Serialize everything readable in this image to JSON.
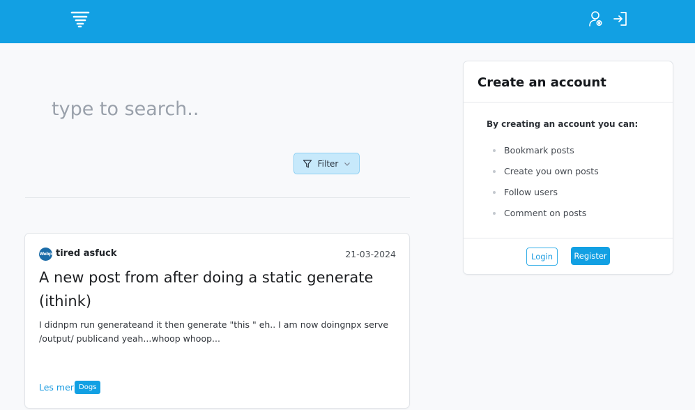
{
  "header": {
    "logo_icon": "tornado-logo-icon",
    "user_icon": "user-settings-icon",
    "login_icon": "sign-in-icon",
    "background": "#12a0e3"
  },
  "search": {
    "placeholder": "type to search..",
    "value": ""
  },
  "filter": {
    "label": "Filter",
    "icon": "funnel-icon",
    "chevron_icon": "chevron-down-icon"
  },
  "post": {
    "avatar_text": "Webp",
    "author": "tired asfuck",
    "date": "21-03-2024",
    "title": "A new post from after doing a static generate (ithink)",
    "body": "I didnpm run generateand it then generate \"this \" eh.. I am now doingnpx serve /output/ publicand yeah...whoop whoop...",
    "read_more": "Les mer",
    "tag": "Dogs"
  },
  "account_card": {
    "title": "Create an account",
    "subtitle": "By creating an account you can:",
    "benefits": [
      "Bookmark posts",
      "Create you own posts",
      "Follow users",
      "Comment on posts"
    ],
    "login_label": "Login",
    "register_label": "Register"
  }
}
